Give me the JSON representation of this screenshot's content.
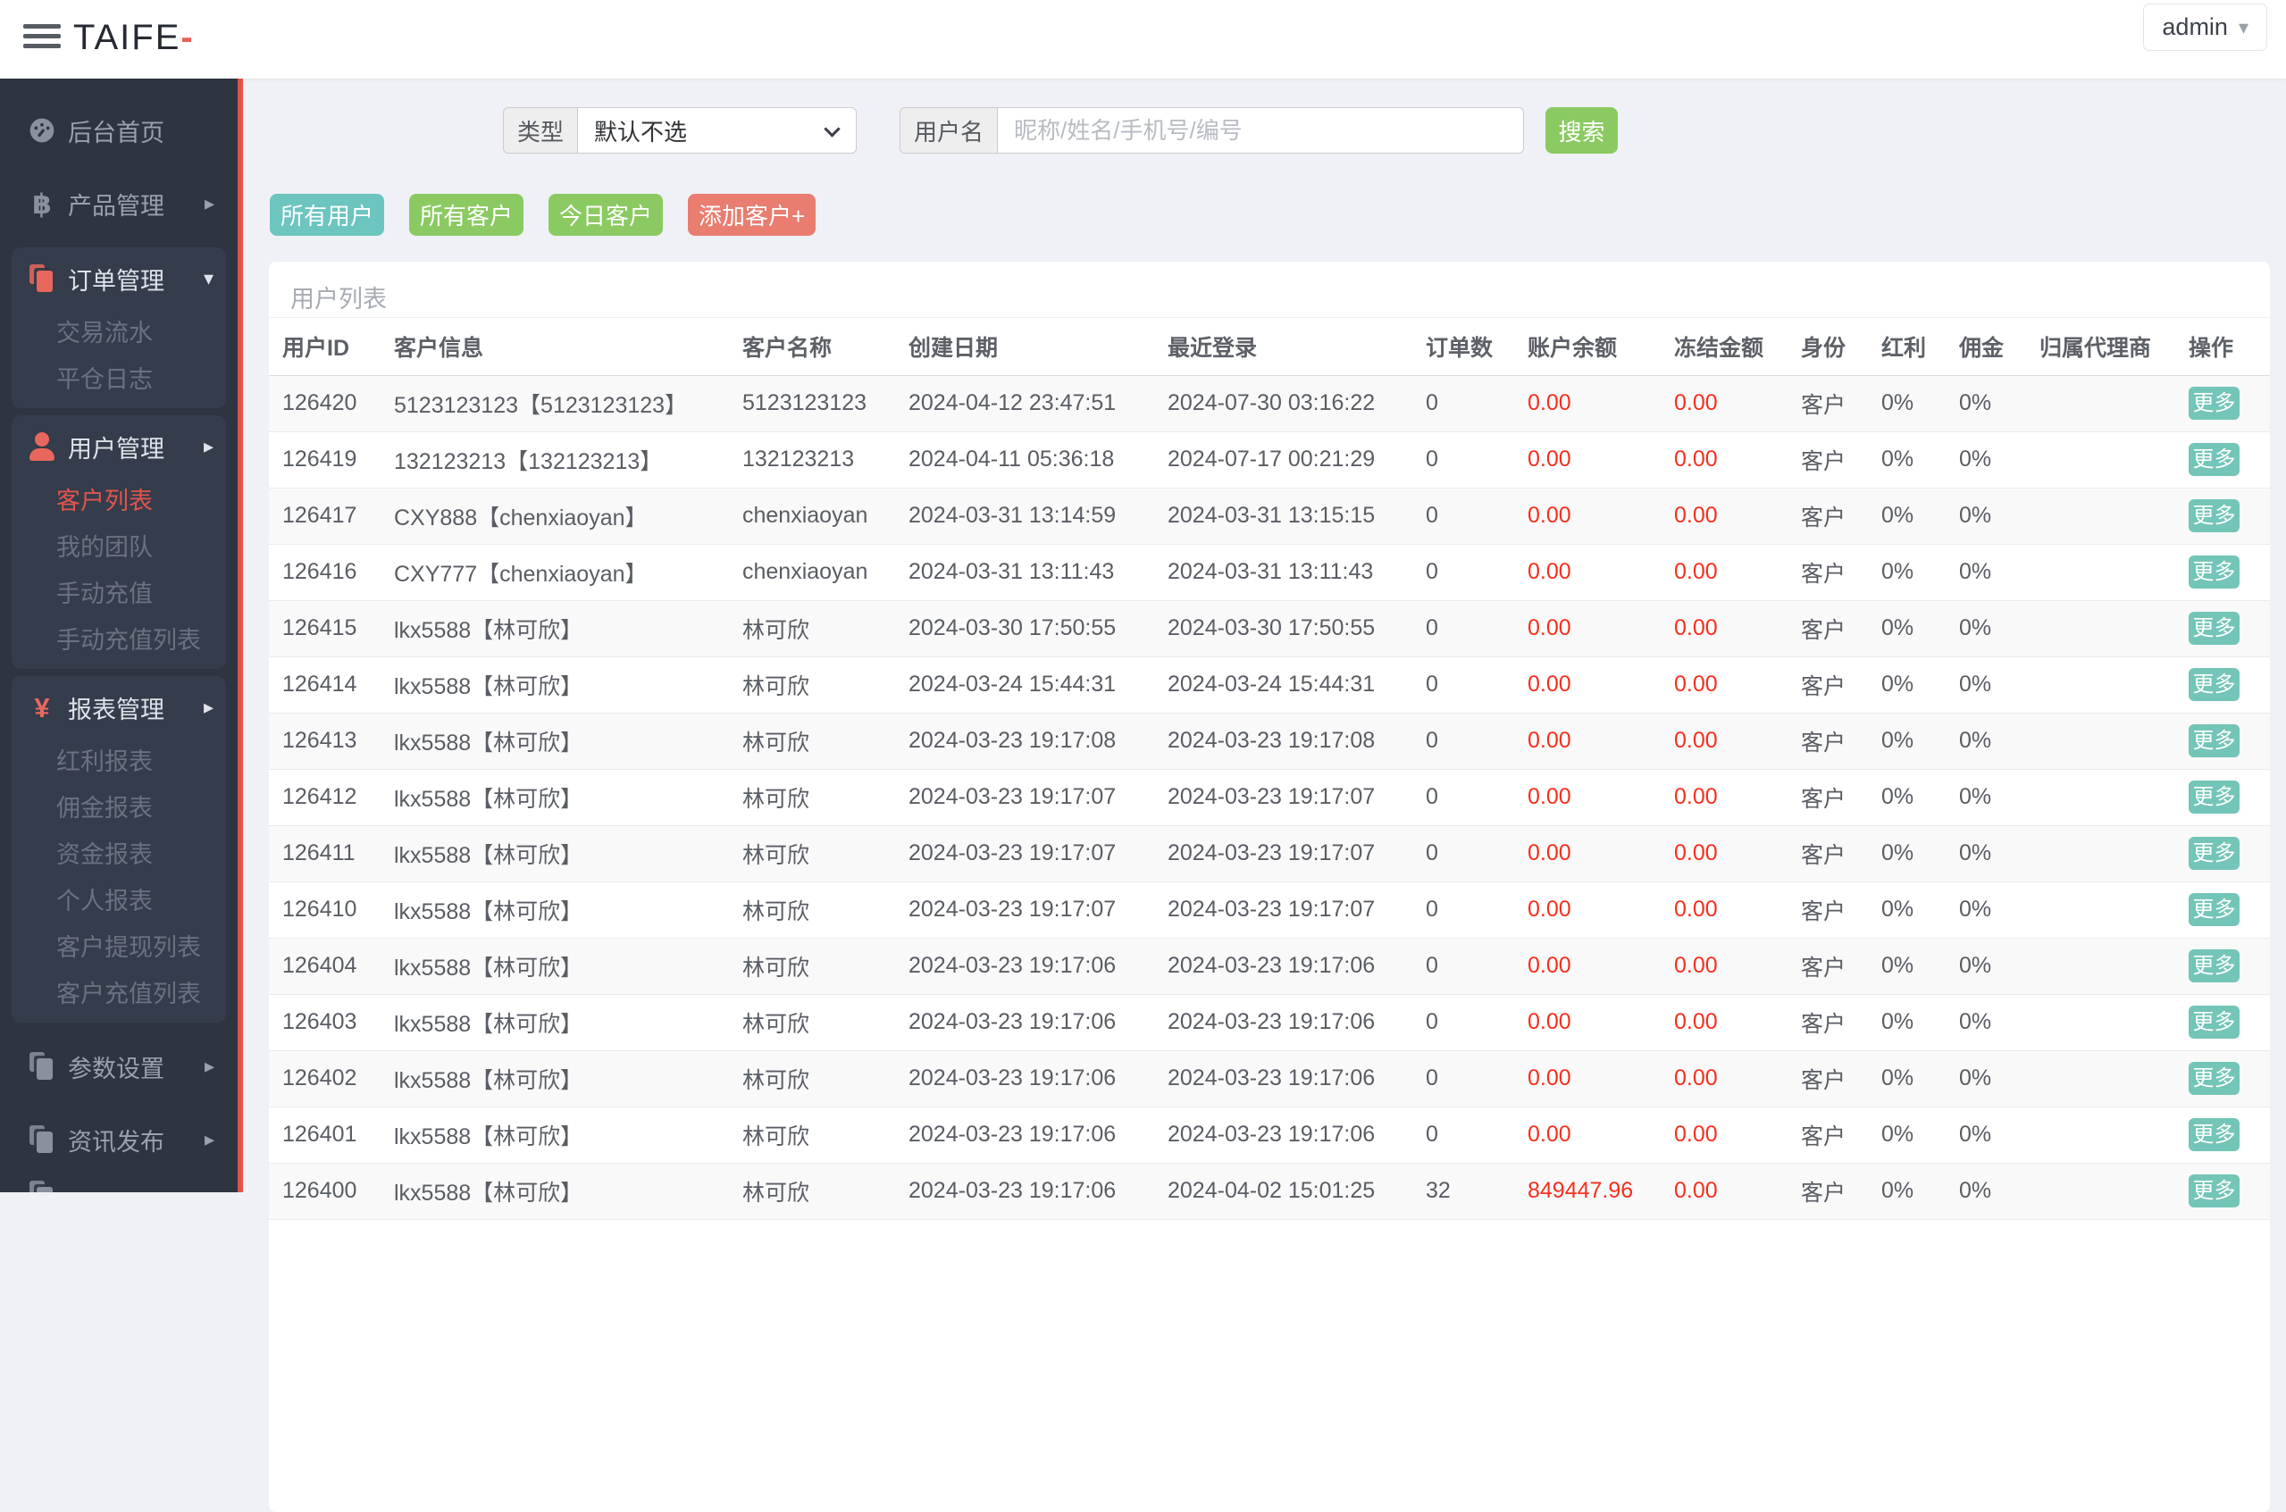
{
  "app": {
    "logo_text": "TAIFE",
    "logo_accent": "-",
    "user_menu": "admin"
  },
  "colors": {
    "sidebar_bg": "#2e3442",
    "sidebar_group_bg": "#353c4b",
    "accent_stripe": "#e25349",
    "active_menu": "#e0554d",
    "teal_button": "#6cc5bf",
    "green_button": "#8bca62",
    "red_button": "#e87d70",
    "more_button": "#73c5b7",
    "amount_red": "#f5301d"
  },
  "sidebar": {
    "items": [
      {
        "label": "后台首页",
        "icon": "dashboard-icon"
      },
      {
        "label": "产品管理",
        "icon": "bitcoin-icon",
        "arrow": "▸"
      },
      {
        "label": "订单管理",
        "icon": "orders-icon",
        "arrow": "▾",
        "children": [
          {
            "label": "交易流水"
          },
          {
            "label": "平仓日志"
          }
        ]
      },
      {
        "label": "用户管理",
        "icon": "user-icon",
        "arrow": "▸",
        "children": [
          {
            "label": "客户列表",
            "active": true
          },
          {
            "label": "我的团队"
          },
          {
            "label": "手动充值"
          },
          {
            "label": "手动充值列表"
          }
        ]
      },
      {
        "label": "报表管理",
        "icon": "yen-icon",
        "arrow": "▸",
        "children": [
          {
            "label": "红利报表"
          },
          {
            "label": "佣金报表"
          },
          {
            "label": "资金报表"
          },
          {
            "label": "个人报表"
          },
          {
            "label": "客户提现列表"
          },
          {
            "label": "客户充值列表"
          }
        ]
      },
      {
        "label": "参数设置",
        "icon": "docs-icon",
        "arrow": "▸"
      },
      {
        "label": "资讯发布",
        "icon": "docs-icon",
        "arrow": "▸"
      }
    ]
  },
  "filters": {
    "type_label": "类型",
    "type_value": "默认不选",
    "username_label": "用户名",
    "username_placeholder": "昵称/姓名/手机号/编号",
    "search_label": "搜索"
  },
  "action_buttons": [
    {
      "label": "所有用户",
      "style": "teal"
    },
    {
      "label": "所有客户",
      "style": "green"
    },
    {
      "label": "今日客户",
      "style": "green"
    },
    {
      "label": "添加客户+",
      "style": "red"
    }
  ],
  "table": {
    "title": "用户列表",
    "action_label": "更多",
    "columns": [
      "用户ID",
      "客户信息",
      "客户名称",
      "创建日期",
      "最近登录",
      "订单数",
      "账户余额",
      "冻结金额",
      "身份",
      "红利",
      "佣金",
      "归属代理商",
      "操作"
    ],
    "rows": [
      {
        "id": "126420",
        "info": "5123123123【5123123123】",
        "name": "5123123123",
        "created": "2024-04-12 23:47:51",
        "login": "2024-07-30 03:16:22",
        "orders": "0",
        "balance": "0.00",
        "frozen": "0.00",
        "role": "客户",
        "bonus": "0%",
        "commission": "0%",
        "agent": ""
      },
      {
        "id": "126419",
        "info": "132123213【132123213】",
        "name": "132123213",
        "created": "2024-04-11 05:36:18",
        "login": "2024-07-17 00:21:29",
        "orders": "0",
        "balance": "0.00",
        "frozen": "0.00",
        "role": "客户",
        "bonus": "0%",
        "commission": "0%",
        "agent": ""
      },
      {
        "id": "126417",
        "info": "CXY888【chenxiaoyan】",
        "name": "chenxiaoyan",
        "created": "2024-03-31 13:14:59",
        "login": "2024-03-31 13:15:15",
        "orders": "0",
        "balance": "0.00",
        "frozen": "0.00",
        "role": "客户",
        "bonus": "0%",
        "commission": "0%",
        "agent": ""
      },
      {
        "id": "126416",
        "info": "CXY777【chenxiaoyan】",
        "name": "chenxiaoyan",
        "created": "2024-03-31 13:11:43",
        "login": "2024-03-31 13:11:43",
        "orders": "0",
        "balance": "0.00",
        "frozen": "0.00",
        "role": "客户",
        "bonus": "0%",
        "commission": "0%",
        "agent": ""
      },
      {
        "id": "126415",
        "info": "lkx5588【林可欣】",
        "name": "林可欣",
        "created": "2024-03-30 17:50:55",
        "login": "2024-03-30 17:50:55",
        "orders": "0",
        "balance": "0.00",
        "frozen": "0.00",
        "role": "客户",
        "bonus": "0%",
        "commission": "0%",
        "agent": ""
      },
      {
        "id": "126414",
        "info": "lkx5588【林可欣】",
        "name": "林可欣",
        "created": "2024-03-24 15:44:31",
        "login": "2024-03-24 15:44:31",
        "orders": "0",
        "balance": "0.00",
        "frozen": "0.00",
        "role": "客户",
        "bonus": "0%",
        "commission": "0%",
        "agent": ""
      },
      {
        "id": "126413",
        "info": "lkx5588【林可欣】",
        "name": "林可欣",
        "created": "2024-03-23 19:17:08",
        "login": "2024-03-23 19:17:08",
        "orders": "0",
        "balance": "0.00",
        "frozen": "0.00",
        "role": "客户",
        "bonus": "0%",
        "commission": "0%",
        "agent": ""
      },
      {
        "id": "126412",
        "info": "lkx5588【林可欣】",
        "name": "林可欣",
        "created": "2024-03-23 19:17:07",
        "login": "2024-03-23 19:17:07",
        "orders": "0",
        "balance": "0.00",
        "frozen": "0.00",
        "role": "客户",
        "bonus": "0%",
        "commission": "0%",
        "agent": ""
      },
      {
        "id": "126411",
        "info": "lkx5588【林可欣】",
        "name": "林可欣",
        "created": "2024-03-23 19:17:07",
        "login": "2024-03-23 19:17:07",
        "orders": "0",
        "balance": "0.00",
        "frozen": "0.00",
        "role": "客户",
        "bonus": "0%",
        "commission": "0%",
        "agent": ""
      },
      {
        "id": "126410",
        "info": "lkx5588【林可欣】",
        "name": "林可欣",
        "created": "2024-03-23 19:17:07",
        "login": "2024-03-23 19:17:07",
        "orders": "0",
        "balance": "0.00",
        "frozen": "0.00",
        "role": "客户",
        "bonus": "0%",
        "commission": "0%",
        "agent": ""
      },
      {
        "id": "126404",
        "info": "lkx5588【林可欣】",
        "name": "林可欣",
        "created": "2024-03-23 19:17:06",
        "login": "2024-03-23 19:17:06",
        "orders": "0",
        "balance": "0.00",
        "frozen": "0.00",
        "role": "客户",
        "bonus": "0%",
        "commission": "0%",
        "agent": ""
      },
      {
        "id": "126403",
        "info": "lkx5588【林可欣】",
        "name": "林可欣",
        "created": "2024-03-23 19:17:06",
        "login": "2024-03-23 19:17:06",
        "orders": "0",
        "balance": "0.00",
        "frozen": "0.00",
        "role": "客户",
        "bonus": "0%",
        "commission": "0%",
        "agent": ""
      },
      {
        "id": "126402",
        "info": "lkx5588【林可欣】",
        "name": "林可欣",
        "created": "2024-03-23 19:17:06",
        "login": "2024-03-23 19:17:06",
        "orders": "0",
        "balance": "0.00",
        "frozen": "0.00",
        "role": "客户",
        "bonus": "0%",
        "commission": "0%",
        "agent": ""
      },
      {
        "id": "126401",
        "info": "lkx5588【林可欣】",
        "name": "林可欣",
        "created": "2024-03-23 19:17:06",
        "login": "2024-03-23 19:17:06",
        "orders": "0",
        "balance": "0.00",
        "frozen": "0.00",
        "role": "客户",
        "bonus": "0%",
        "commission": "0%",
        "agent": ""
      },
      {
        "id": "126400",
        "info": "lkx5588【林可欣】",
        "name": "林可欣",
        "created": "2024-03-23 19:17:06",
        "login": "2024-04-02 15:01:25",
        "orders": "32",
        "balance": "849447.96",
        "frozen": "0.00",
        "role": "客户",
        "bonus": "0%",
        "commission": "0%",
        "agent": ""
      }
    ]
  }
}
